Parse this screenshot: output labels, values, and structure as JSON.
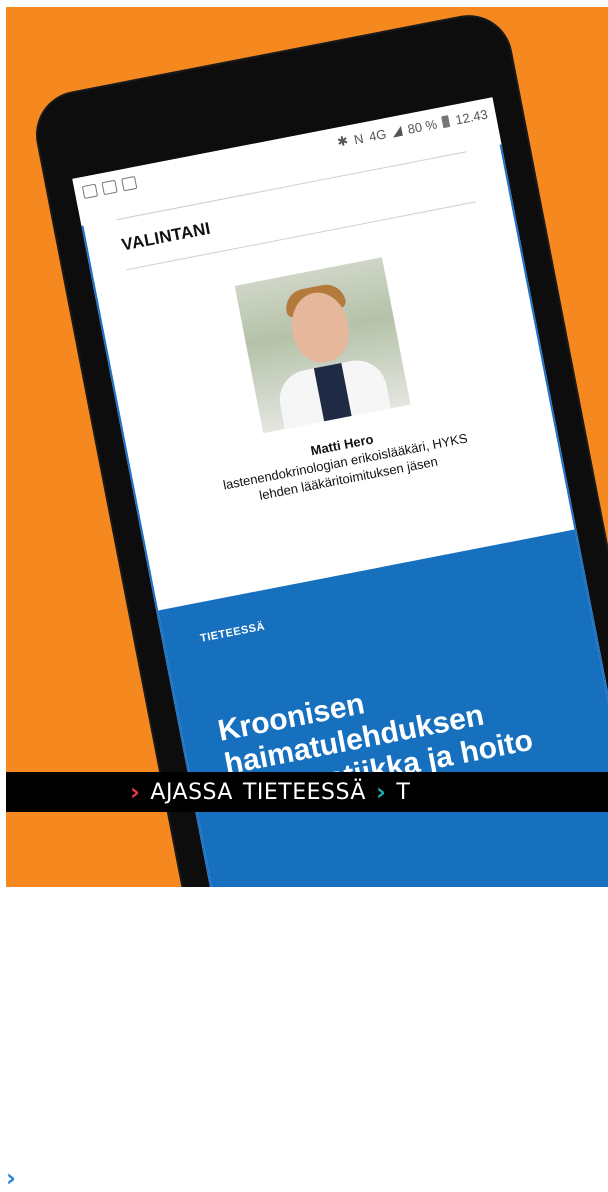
{
  "status": {
    "signal": "4G",
    "battery_percent": "80 %",
    "time": "12.43"
  },
  "article": {
    "section_title": "VALINTANI",
    "person": {
      "name": "Matti Hero",
      "title": "lastenendokrinologian erikoislääkäri, HYKS",
      "role": "lehden lääkäritoimituksen jäsen"
    },
    "kicker": "TIETEESSÄ",
    "headline": "Kroonisen haimatulehduksen diagnostiikka ja hoito"
  },
  "nav": {
    "items": [
      {
        "label": "AJASSA",
        "chevron_color": "#e23a4e"
      },
      {
        "label": "TIETEESSÄ",
        "chevron_color": "#2a7fe0"
      },
      {
        "label": "T",
        "chevron_color": "#22a9b8"
      }
    ]
  },
  "colors": {
    "background": "#F5881F",
    "accent_blue": "#1670BE",
    "nav_bar": "#000000"
  }
}
